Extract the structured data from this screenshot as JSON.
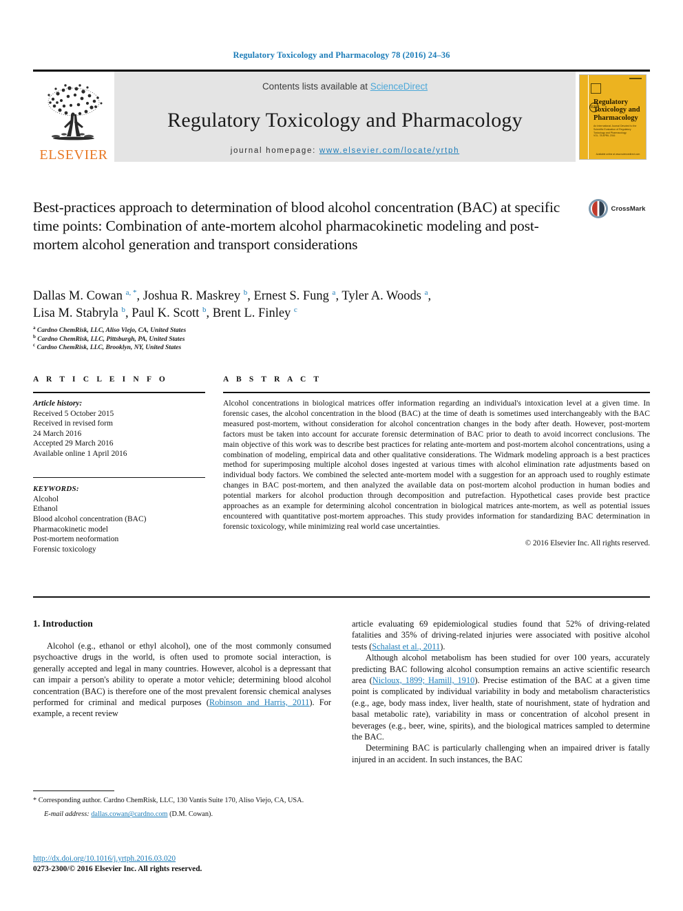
{
  "running_head": "Regulatory Toxicology and Pharmacology 78 (2016) 24–36",
  "masthead": {
    "contents_prefix": "Contents lists available at ",
    "sciencedirect": "ScienceDirect",
    "journal_title": "Regulatory Toxicology and Pharmacology",
    "homepage_prefix": "journal homepage: ",
    "homepage_url": "www.elsevier.com/locate/yrtph",
    "publisher": "ELSEVIER",
    "cover": {
      "title": "Regulatory Toxicology and Pharmacology",
      "subtitle": "An International Journal Devoted to the Scientific Evaluation of Regulatory Toxicology and Pharmacology",
      "issn_top": "ISSN 0273-2300",
      "badge": "RTP",
      "toc": "VOL. 78 APRIL 2016",
      "footer": "Available online at www.sciencedirect.com"
    }
  },
  "article": {
    "title": "Best-practices approach to determination of blood alcohol concentration (BAC) at specific time points: Combination of ante-mortem alcohol pharmacokinetic modeling and post-mortem alcohol generation and transport considerations",
    "crossmark_label": "CrossMark",
    "authors_line1": "Dallas M. Cowan <sup>a, *</sup>, Joshua R. Maskrey <sup>b</sup>, Ernest S. Fung <sup>a</sup>, Tyler A. Woods <sup>a</sup>,",
    "authors_line2": "Lisa M. Stabryla <sup>b</sup>, Paul K. Scott <sup>b</sup>, Brent L. Finley <sup>c</sup>",
    "affiliations": [
      "<sup>a</sup> Cardno ChemRisk, LLC, Aliso Viejo, CA, United States",
      "<sup>b</sup> Cardno ChemRisk, LLC, Pittsburgh, PA, United States",
      "<sup>c</sup> Cardno ChemRisk, LLC, Brooklyn, NY, United States"
    ]
  },
  "article_info": {
    "heading": "A R T I C L E  I N F O",
    "history_label": "Article history:",
    "history": [
      "Received 5 October 2015",
      "Received in revised form",
      "24 March 2016",
      "Accepted 29 March 2016",
      "Available online 1 April 2016"
    ],
    "keywords_label": "KEYWORDS:",
    "keywords": [
      "Alcohol",
      "Ethanol",
      "Blood alcohol concentration (BAC)",
      "Pharmacokinetic model",
      "Post-mortem neoformation",
      "Forensic toxicology"
    ]
  },
  "abstract": {
    "heading": "A B S T R A C T",
    "text": "Alcohol concentrations in biological matrices offer information regarding an individual's intoxication level at a given time. In forensic cases, the alcohol concentration in the blood (BAC) at the time of death is sometimes used interchangeably with the BAC measured post-mortem, without consideration for alcohol concentration changes in the body after death. However, post-mortem factors must be taken into account for accurate forensic determination of BAC prior to death to avoid incorrect conclusions. The main objective of this work was to describe best practices for relating ante-mortem and post-mortem alcohol concentrations, using a combination of modeling, empirical data and other qualitative considerations. The Widmark modeling approach is a best practices method for superimposing multiple alcohol doses ingested at various times with alcohol elimination rate adjustments based on individual body factors. We combined the selected ante-mortem model with a suggestion for an approach used to roughly estimate changes in BAC post-mortem, and then analyzed the available data on post-mortem alcohol production in human bodies and potential markers for alcohol production through decomposition and putrefaction. Hypothetical cases provide best practice approaches as an example for determining alcohol concentration in biological matrices ante-mortem, as well as potential issues encountered with quantitative post-mortem approaches. This study provides information for standardizing BAC determination in forensic toxicology, while minimizing real world case uncertainties.",
    "copyright": "© 2016 Elsevier Inc. All rights reserved."
  },
  "body": {
    "section_heading": "1. Introduction",
    "left_p1": "Alcohol (e.g., ethanol or ethyl alcohol), one of the most commonly consumed psychoactive drugs in the world, is often used to promote social interaction, is generally accepted and legal in many countries. However, alcohol is a depressant that can impair a person's ability to operate a motor vehicle; determining blood alcohol concentration (BAC) is therefore one of the most prevalent forensic chemical analyses performed for criminal and medical purposes (",
    "left_p1_ref": "Robinson and Harris, 2011",
    "left_p1_end": "). For example, a recent review",
    "right_p1": "article evaluating 69 epidemiological studies found that 52% of driving-related fatalities and 35% of driving-related injuries were associated with positive alcohol tests (",
    "right_p1_ref": "Schalast et al., 2011",
    "right_p1_end": ").",
    "right_p2a": "Although alcohol metabolism has been studied for over 100 years, accurately predicting BAC following alcohol consumption remains an active scientific research area (",
    "right_p2_ref": "Nicloux, 1899; Hamill, 1910",
    "right_p2b": "). Precise estimation of the BAC at a given time point is complicated by individual variability in body and metabolism characteristics (e.g., age, body mass index, liver health, state of nourishment, state of hydration and basal metabolic rate), variability in mass or concentration of alcohol present in beverages (e.g., beer, wine, spirits), and the biological matrices sampled to determine the BAC.",
    "right_p3": "Determining BAC is particularly challenging when an impaired driver is fatally injured in an accident. In such instances, the BAC"
  },
  "footnotes": {
    "corresponding": "* Corresponding author. Cardno ChemRisk, LLC, 130 Vantis Suite 170, Aliso Viejo, CA, USA.",
    "email_label": "E-mail address:",
    "email": "dallas.cowan@cardno.com",
    "email_suffix": "(D.M. Cowan)."
  },
  "bottom": {
    "doi": "http://dx.doi.org/10.1016/j.yrtph.2016.03.020",
    "issn": "0273-2300/© 2016 Elsevier Inc. All rights reserved."
  },
  "colors": {
    "link_blue": "#1c7cb8",
    "sciencedirect_blue": "#4aa7d8",
    "elsevier_orange": "#e87722",
    "cover_yellow": "#ecb320",
    "panel_gray": "#e4e4e4"
  }
}
